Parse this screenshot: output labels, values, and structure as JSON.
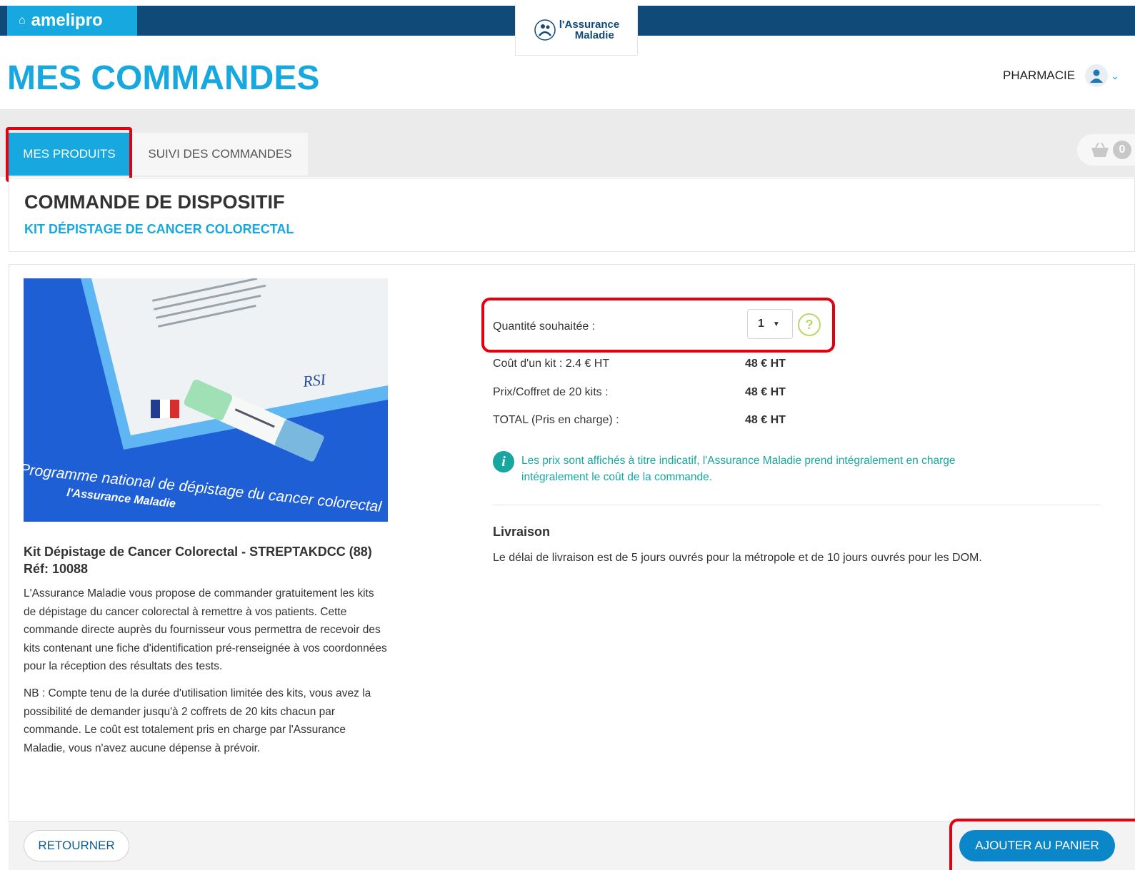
{
  "brand": {
    "name": "amelipro",
    "icon": "home-icon"
  },
  "logo": {
    "line1": "l'Assurance",
    "line2": "Maladie"
  },
  "page_title": "MES COMMANDES",
  "user": {
    "name": "PHARMACIE",
    "icon": "user-icon"
  },
  "tabs": [
    {
      "label": "MES PRODUITS",
      "active": true
    },
    {
      "label": "SUIVI DES COMMANDES",
      "active": false
    }
  ],
  "cart": {
    "count": "0",
    "icon": "basket-icon"
  },
  "section": {
    "title": "COMMANDE DE DISPOSITIF",
    "subtitle": "KIT DÉPISTAGE DE CANCER COLORECTAL"
  },
  "product": {
    "image_caption": "Programme national de dépistage du cancer colorectal",
    "image_logo": "l'Assurance Maladie",
    "title": "Kit Dépistage de Cancer Colorectal - STREPTAKDCC (88) Réf: 10088",
    "description_1": "L'Assurance Maladie vous propose de commander gratuitement les kits de dépistage du cancer colorectal à remettre à vos patients. Cette commande directe auprès du fournisseur vous permettra de recevoir des kits contenant une fiche d'identification pré-renseignée à vos coordonnées pour la réception des résultats des tests.",
    "description_2": "NB : Compte tenu de la durée d'utilisation limitée des kits, vous avez la possibilité de demander jusqu'à 2 coffrets de 20 kits chacun par commande. Le coût est totalement pris en charge par l'Assurance Maladie, vous n'avez aucune dépense à prévoir."
  },
  "order": {
    "quantity_label": "Quantité souhaitée :",
    "quantity_value": "1",
    "rows": [
      {
        "label": "Coût d'un kit : 2.4 € HT",
        "value": "48 € HT"
      },
      {
        "label": "Prix/Coffret de 20 kits :",
        "value": "48 € HT"
      },
      {
        "label": "TOTAL (Pris en charge) :",
        "value": "48 € HT"
      }
    ],
    "info": "Les prix sont affichés à titre indicatif, l'Assurance Maladie prend intégralement en charge intégralement le coût de la commande."
  },
  "delivery": {
    "title": "Livraison",
    "text": "Le délai de livraison est de 5 jours ouvrés pour la métropole et de 10 jours ouvrés pour les DOM."
  },
  "buttons": {
    "back": "RETOURNER",
    "add_to_cart": "AJOUTER AU PANIER"
  },
  "colors": {
    "primary": "#18a8e0",
    "navy": "#0f4a78",
    "highlight": "#e3000f",
    "info": "#17a6a0"
  }
}
